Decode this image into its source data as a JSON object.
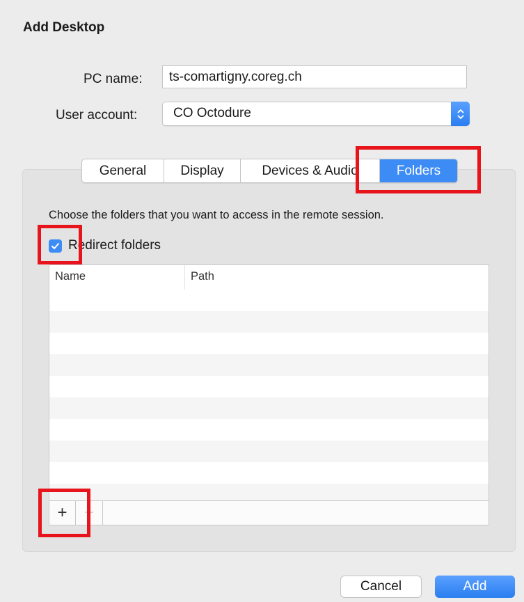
{
  "dialog": {
    "title": "Add Desktop"
  },
  "form": {
    "pc_name_label": "PC name:",
    "pc_name_value": "ts-comartigny.coreg.ch",
    "user_account_label": "User account:",
    "user_account_value": "CO Octodure"
  },
  "tabs": [
    {
      "label": "General"
    },
    {
      "label": "Display"
    },
    {
      "label": "Devices & Audio"
    },
    {
      "label": "Folders"
    }
  ],
  "folders": {
    "description": "Choose the folders that you want to access in the remote session.",
    "redirect_label": "Redirect folders",
    "redirect_checked": true,
    "columns": [
      "Name",
      "Path"
    ],
    "add_symbol": "+",
    "remove_symbol": "−"
  },
  "buttons": {
    "cancel": "Cancel",
    "add": "Add"
  },
  "colors": {
    "accent": "#3d8cf5",
    "highlight": "#e8141b"
  },
  "icons": [
    "chevron-updown-icon",
    "checkmark-icon"
  ]
}
